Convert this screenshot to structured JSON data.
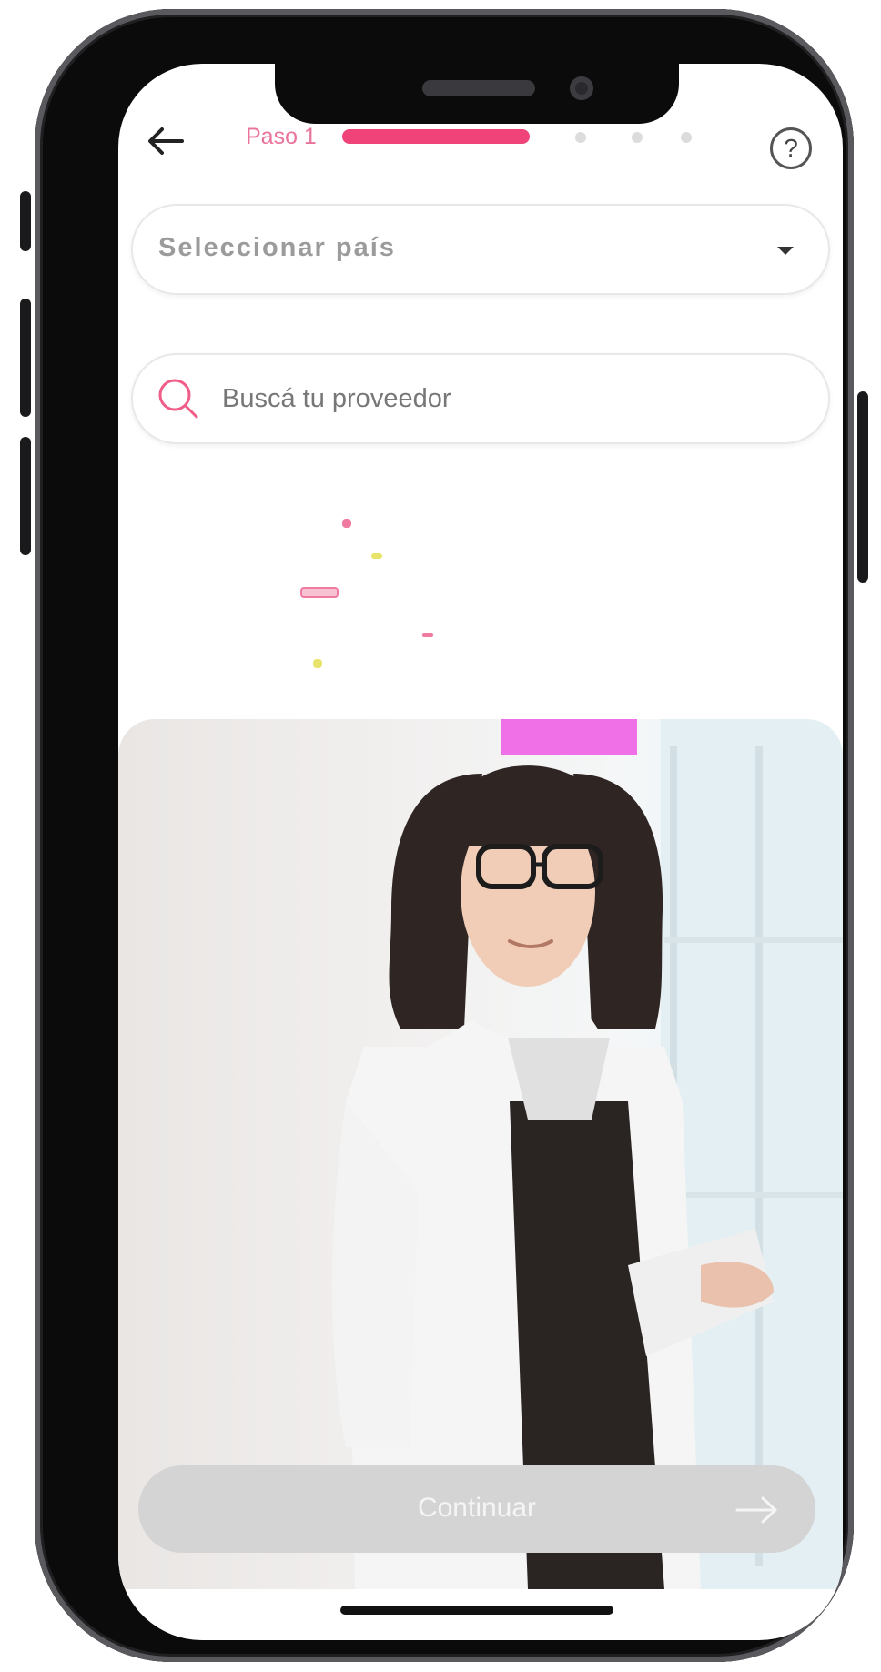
{
  "header": {
    "step_label": "Paso 1",
    "progress": {
      "current_step": 1,
      "total_steps": 4
    }
  },
  "form": {
    "country_select_placeholder": "Seleccionar país",
    "provider_search_placeholder": "Buscá tu proveedor"
  },
  "actions": {
    "continue_label": "Continuar"
  },
  "colors": {
    "accent": "#f0437a",
    "step_text": "#e9749a",
    "button_disabled": "#d4d4d4"
  },
  "icons": [
    "arrow-left-icon",
    "help-icon",
    "chevron-down-icon",
    "search-icon",
    "arrow-right-icon"
  ]
}
